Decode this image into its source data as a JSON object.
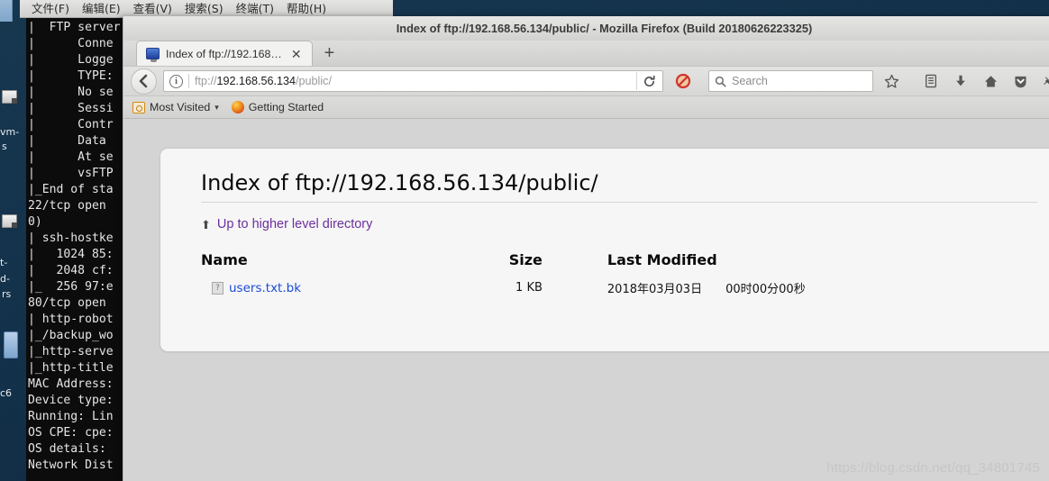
{
  "desktop": {
    "icon_labels": [
      "vm-",
      "s",
      "t-",
      "d-",
      "rs",
      "c6"
    ]
  },
  "terminal": {
    "menus": [
      {
        "label": "文件(F)"
      },
      {
        "label": "编辑(E)"
      },
      {
        "label": "查看(V)"
      },
      {
        "label": "搜索(S)"
      },
      {
        "label": "终端(T)"
      },
      {
        "label": "帮助(H)"
      }
    ],
    "output": "|  FTP server\n|      Conne\n|      Logge\n|      TYPE:\n|      No se\n|      Sessi\n|      Contr\n|      Data\n|      At se\n|      vsFTP\n|_End of sta\n22/tcp open\n0)\n| ssh-hostke\n|   1024 85:\n|   2048 cf:\n|_  256 97:e\n80/tcp open\n| http-robot\n|_/backup_wo\n|_http-serve\n|_http-title\nMAC Address:\nDevice type:\nRunning: Lin\nOS CPE: cpe:\nOS details:\nNetwork Dist"
  },
  "browser": {
    "window_title": "Index of ftp://192.168.56.134/public/ - Mozilla Firefox (Build 20180626223325)",
    "tab": {
      "label": "Index of ftp://192.168…",
      "close_label": "✕",
      "favicon": "monitor-icon"
    },
    "new_tab_label": "+",
    "urlbar": {
      "scheme": "ftp://",
      "host": "192.168.56.134",
      "path": "/public/",
      "full_value": "ftp://192.168.56.134/public/",
      "identity_icon_glyph": "i"
    },
    "search": {
      "placeholder": "Search"
    },
    "toolbar_icons": [
      {
        "name": "bookmark-star-icon"
      },
      {
        "name": "library-icon"
      },
      {
        "name": "downloads-icon"
      },
      {
        "name": "home-icon"
      },
      {
        "name": "pocket-icon"
      },
      {
        "name": "noscript-options-icon"
      }
    ],
    "bookmarks": [
      {
        "label": "Most Visited",
        "icon": "most-visited-icon",
        "chevron": "▾"
      },
      {
        "label": "Getting Started",
        "icon": "firefox-icon"
      }
    ]
  },
  "page": {
    "heading": "Index of ftp://192.168.56.134/public/",
    "up_directory_label": "Up to higher level directory",
    "up_arrow_glyph": "⬆",
    "columns": {
      "name": "Name",
      "size": "Size",
      "last_modified": "Last Modified"
    },
    "rows": [
      {
        "name": "users.txt.bk",
        "size": "1 KB",
        "modified_date": "2018年03月03日",
        "modified_time": "00时00分00秒",
        "icon_glyph": "?"
      }
    ]
  },
  "watermark": "https://blog.csdn.net/qq_34801745",
  "colors": {
    "link": "#1a4ad6",
    "visited_link": "#6b2f9e",
    "terminal_bg": "#0c0c0c",
    "page_bg": "#d4d4d4"
  }
}
